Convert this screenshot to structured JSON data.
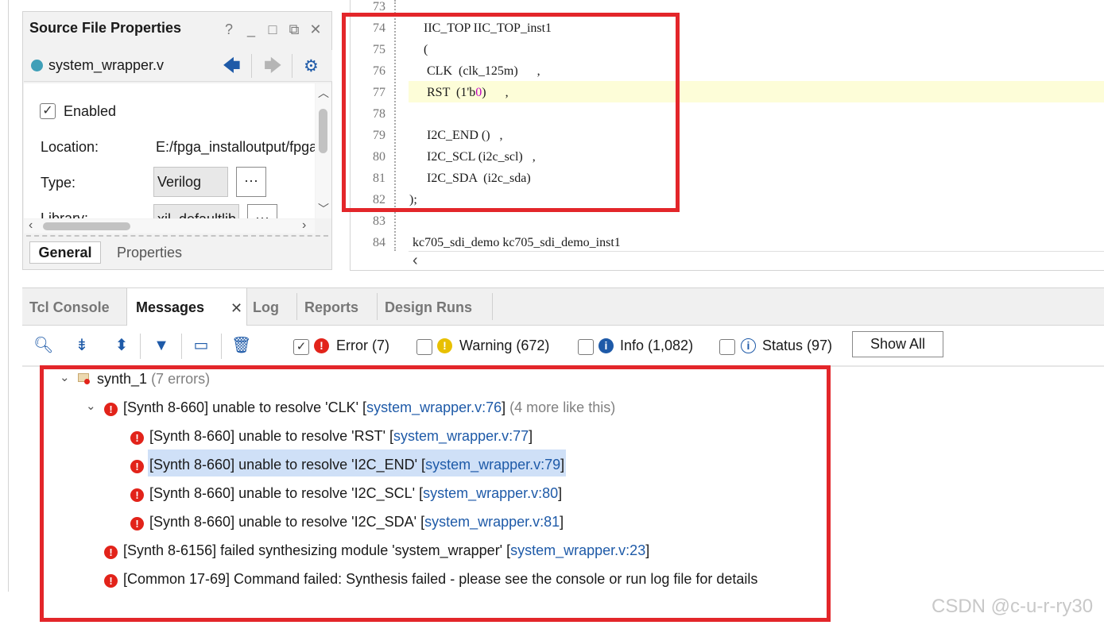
{
  "source_props": {
    "title": "Source File Properties",
    "title_buttons": [
      "?",
      "_",
      "□",
      "⧉",
      "✕"
    ],
    "file_name": "system_wrapper.v",
    "enabled_label": "Enabled",
    "enabled_checked": true,
    "location_label": "Location:",
    "location_value": "E:/fpga_installoutput/fpga",
    "type_label": "Type:",
    "type_value": "Verilog",
    "library_label": "Library:",
    "library_value": "xil_defaultlib",
    "ellipsis": "···",
    "tabs": {
      "general": "General",
      "properties": "Properties"
    }
  },
  "editor": {
    "line_numbers": [
      "73",
      "74",
      "75",
      "76",
      "77",
      "78",
      "79",
      "80",
      "81",
      "82",
      "83",
      "84"
    ],
    "lines": [
      "",
      "  IIC_TOP IIC_TOP_inst1",
      "  (",
      "   CLK  (clk_125m)      ,",
      "   RST  (1'b0)      ,",
      "",
      "   I2C_END ()   ,",
      "   I2C_SCL (i2c_scl)   ,",
      "   I2C_SDA  (i2c_sda)",
      ");",
      "",
      " kc705_sdi_demo kc705_sdi_demo_inst1"
    ],
    "rst_prefix": "   RST  (1'b",
    "rst_num": "0",
    "rst_suffix": ")      ,",
    "highlighted_line": "77"
  },
  "messages": {
    "tabs": [
      "Tcl Console",
      "Messages",
      "Log",
      "Reports",
      "Design Runs"
    ],
    "active_tab": "Messages",
    "filters": {
      "error": {
        "label": "Error (7)",
        "checked": true
      },
      "warning": {
        "label": "Warning (672)",
        "checked": false
      },
      "info": {
        "label": "Info (1,082)",
        "checked": false
      },
      "status": {
        "label": "Status (97)",
        "checked": false
      }
    },
    "show_all": "Show All",
    "group": {
      "name": "synth_1",
      "count": "(7 errors)"
    },
    "parent_error": {
      "text": "[Synth 8-660] unable to resolve 'CLK' [",
      "link": "system_wrapper.v:76",
      "suffix": "]",
      "more": "(4 more like this)"
    },
    "child_errors": [
      {
        "text": "[Synth 8-660] unable to resolve 'RST' [",
        "link": "system_wrapper.v:77",
        "suffix": "]"
      },
      {
        "text": "[Synth 8-660] unable to resolve 'I2C_END' [",
        "link": "system_wrapper.v:79",
        "suffix": "]"
      },
      {
        "text": "[Synth 8-660] unable to resolve 'I2C_SCL' [",
        "link": "system_wrapper.v:80",
        "suffix": "]"
      },
      {
        "text": "[Synth 8-660] unable to resolve 'I2C_SDA' [",
        "link": "system_wrapper.v:81",
        "suffix": "]"
      }
    ],
    "other_errors": [
      {
        "text": "[Synth 8-6156] failed synthesizing module 'system_wrapper' [",
        "link": "system_wrapper.v:23",
        "suffix": "]"
      },
      {
        "text": "[Common 17-69] Command failed: Synthesis failed - please see the console or run log file for details",
        "link": "",
        "suffix": ""
      }
    ],
    "selected_index": 1
  },
  "watermark": "CSDN @c-u-r-ry30",
  "colors": {
    "error_red": "#e2231a",
    "warning_yellow": "#e8c000",
    "info_blue": "#1e5aa8",
    "link_blue": "#1e5aa8",
    "annotation_red": "#e3262a",
    "selection": "#cfe0f7",
    "line_highlight": "#fdfdd8"
  },
  "icons": {
    "help": "help-icon",
    "minimize": "minimize-icon",
    "maximize": "maximize-icon",
    "float": "float-icon",
    "close": "close-icon",
    "back": "back-arrow-icon",
    "forward": "forward-arrow-icon",
    "settings": "gear-icon"
  }
}
